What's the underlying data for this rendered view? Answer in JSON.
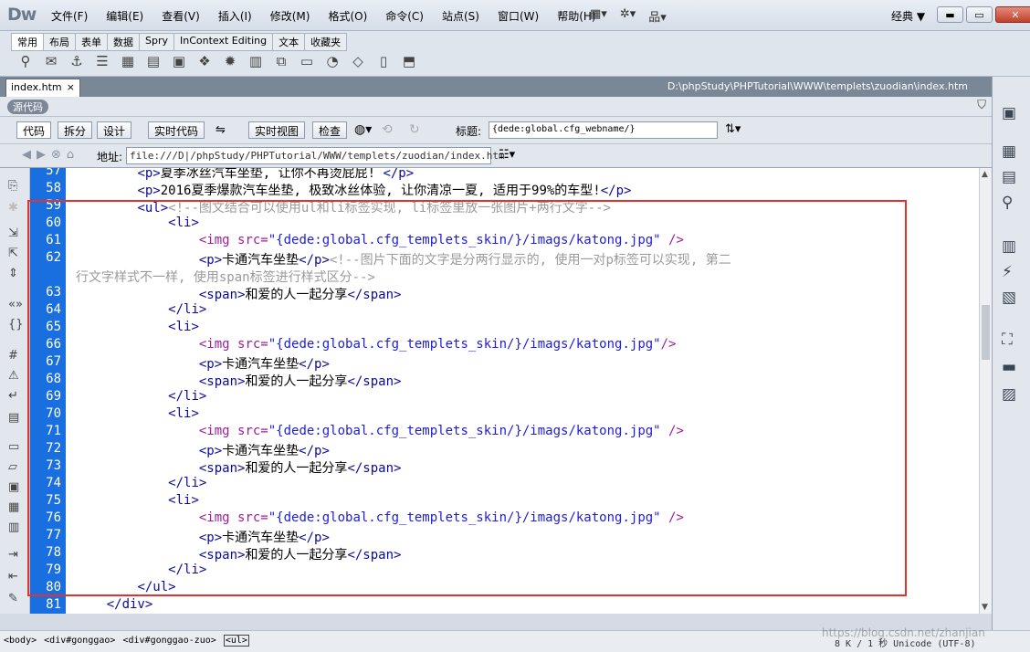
{
  "app": {
    "logo": "Dw",
    "menu": [
      "文件(F)",
      "编辑(E)",
      "查看(V)",
      "插入(I)",
      "修改(M)",
      "格式(O)",
      "命令(C)",
      "站点(S)",
      "窗口(W)",
      "帮助(H)"
    ],
    "toolbar_icons": [
      "layout-icon",
      "gear-icon",
      "site-icon"
    ],
    "workspace": "经典 ▼",
    "window_buttons": [
      "minimize",
      "restore",
      "close"
    ]
  },
  "insert_panel": {
    "tabs": [
      "常用",
      "布局",
      "表单",
      "数据",
      "Spry",
      "InContext Editing",
      "文本",
      "收藏夹"
    ],
    "active_tab": "常用"
  },
  "document": {
    "tab_label": "index.htm",
    "close_glyph": "×",
    "path": "D:\\phpStudy\\PHPTutorial\\WWW\\templets\\zuodian\\index.htm",
    "source_tag": "源代码"
  },
  "doc_toolbar": {
    "code": "代码",
    "split": "拆分",
    "design": "设计",
    "live_code": "实时代码",
    "live_view": "实时视图",
    "inspect": "检查",
    "title_label": "标题:",
    "title_value": "{dede:global.cfg_webname/}"
  },
  "address": {
    "label": "地址:",
    "value": "file:///D|/phpStudy/PHPTutorial/WWW/templets/zuodian/index.htm"
  },
  "code_lines": [
    {
      "n": "57",
      "html": "        <span class='t'>&lt;p&gt;</span>夏季冰丝汽车坐垫, 让你不再烫屁屁! <span class='t'>&lt;/p&gt;</span>"
    },
    {
      "n": "58",
      "html": "        <span class='t'>&lt;p&gt;</span>2016夏季爆款汽车坐垫, 极致冰丝体验, 让你清凉一夏, 适用于99%的车型!<span class='t'>&lt;/p&gt;</span>"
    },
    {
      "n": "59",
      "html": "        <span class='t'>&lt;ul&gt;</span><span class='c'>&lt;!--图文结合可以使用ul和li标签实现, li标签里放一张图片+两行文字--&gt;</span>"
    },
    {
      "n": "60",
      "html": "            <span class='t'>&lt;li&gt;</span>"
    },
    {
      "n": "61",
      "html": "                <span class='a'>&lt;img</span> <span class='a'>src=</span><span class='v'>\"{dede:global.cfg_templets_skin/}/imags/katong.jpg\"</span> <span class='a'>/&gt;</span>"
    },
    {
      "n": "62",
      "html": "                <span class='t'>&lt;p&gt;</span>卡通汽车坐垫<span class='t'>&lt;/p&gt;</span><span class='c'>&lt;!--图片下面的文字是分两行显示的, 使用一对p标签可以实现, 第二</span>"
    },
    {
      "n": "",
      "html": "<span class='c'>行文字样式不一样, 使用span标签进行样式区分--&gt;</span>",
      "wrap": true
    },
    {
      "n": "63",
      "html": "                <span class='t'>&lt;span&gt;</span>和爱的人一起分享<span class='t'>&lt;/span&gt;</span>"
    },
    {
      "n": "64",
      "html": "            <span class='t'>&lt;/li&gt;</span>"
    },
    {
      "n": "65",
      "html": "            <span class='t'>&lt;li&gt;</span>"
    },
    {
      "n": "66",
      "html": "                <span class='a'>&lt;img</span> <span class='a'>src=</span><span class='v'>\"{dede:global.cfg_templets_skin/}/imags/katong.jpg\"</span><span class='a'>/&gt;</span>"
    },
    {
      "n": "67",
      "html": "                <span class='t'>&lt;p&gt;</span>卡通汽车坐垫<span class='t'>&lt;/p&gt;</span>"
    },
    {
      "n": "68",
      "html": "                <span class='t'>&lt;span&gt;</span>和爱的人一起分享<span class='t'>&lt;/span&gt;</span>"
    },
    {
      "n": "69",
      "html": "            <span class='t'>&lt;/li&gt;</span>"
    },
    {
      "n": "70",
      "html": "            <span class='t'>&lt;li&gt;</span>"
    },
    {
      "n": "71",
      "html": "                <span class='a'>&lt;img</span> <span class='a'>src=</span><span class='v'>\"{dede:global.cfg_templets_skin/}/imags/katong.jpg\"</span> <span class='a'>/&gt;</span>"
    },
    {
      "n": "72",
      "html": "                <span class='t'>&lt;p&gt;</span>卡通汽车坐垫<span class='t'>&lt;/p&gt;</span>"
    },
    {
      "n": "73",
      "html": "                <span class='t'>&lt;span&gt;</span>和爱的人一起分享<span class='t'>&lt;/span&gt;</span>"
    },
    {
      "n": "74",
      "html": "            <span class='t'>&lt;/li&gt;</span>"
    },
    {
      "n": "75",
      "html": "            <span class='t'>&lt;li&gt;</span>"
    },
    {
      "n": "76",
      "html": "                <span class='a'>&lt;img</span> <span class='a'>src=</span><span class='v'>\"{dede:global.cfg_templets_skin/}/imags/katong.jpg\"</span> <span class='a'>/&gt;</span>"
    },
    {
      "n": "77",
      "html": "                <span class='t'>&lt;p&gt;</span>卡通汽车坐垫<span class='t'>&lt;/p&gt;</span>"
    },
    {
      "n": "78",
      "html": "                <span class='t'>&lt;span&gt;</span>和爱的人一起分享<span class='t'>&lt;/span&gt;</span>"
    },
    {
      "n": "79",
      "html": "            <span class='t'>&lt;/li&gt;</span>"
    },
    {
      "n": "80",
      "html": "        <span class='t'>&lt;/ul&gt;</span>"
    },
    {
      "n": "81",
      "html": "    <span class='t'>&lt;/div&gt;</span>"
    }
  ],
  "status": {
    "tag_selector": [
      "<body>",
      "<div#gonggao>",
      "<div#gonggao-zuo>"
    ],
    "current_tag": "<ul>",
    "encoding": "8 K / 1 秒 Unicode (UTF-8)"
  },
  "watermark": "https://blog.csdn.net/zhanjian",
  "colors": {
    "gutter": "#1a6fe0",
    "highlight_box": "#e2332d",
    "tag": "#0a0a9a",
    "attribute": "#9c1d9c",
    "value": "#1d1dd8",
    "comment": "#9a9a9a"
  }
}
